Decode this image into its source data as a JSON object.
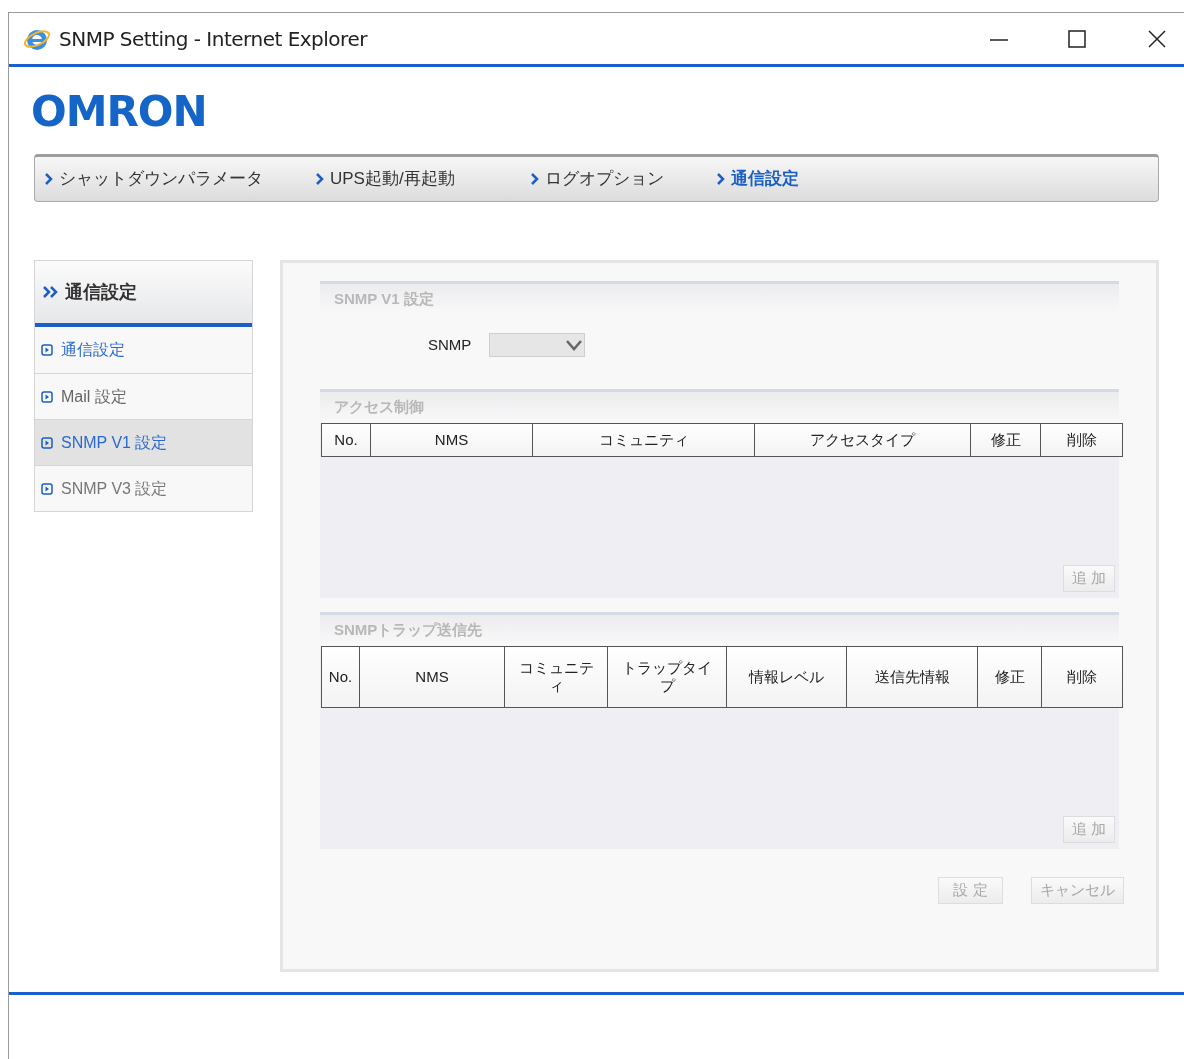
{
  "window": {
    "title": "SNMP Setting - Internet Explorer"
  },
  "logo": "OMRON",
  "nav": [
    {
      "label": "シャットダウンパラメータ",
      "selected": false
    },
    {
      "label": "UPS起動/再起動",
      "selected": false
    },
    {
      "label": "ログオプション",
      "selected": false
    },
    {
      "label": "通信設定",
      "selected": true
    }
  ],
  "sidebar": {
    "title": "通信設定",
    "items": [
      {
        "label": "通信設定",
        "selected": false,
        "color": "#2a6ad0"
      },
      {
        "label": "Mail 設定",
        "selected": false,
        "color": "#666666"
      },
      {
        "label": "SNMP V1 設定",
        "selected": true,
        "color": "#2a6ad0"
      },
      {
        "label": "SNMP V3 設定",
        "selected": false,
        "color": "#777777"
      }
    ]
  },
  "sections": [
    {
      "title": "SNMP V1 設定",
      "kind": "form",
      "field_label": "SNMP"
    },
    {
      "title": "アクセス制御",
      "kind": "table",
      "columns": [
        "No.",
        "NMS",
        "コミュニティ",
        "アクセスタイプ",
        "修正",
        "削除"
      ],
      "add_button": {
        "label": "追 加",
        "disabled": true
      }
    },
    {
      "title": "SNMPトラップ送信先",
      "kind": "table",
      "columns": [
        "No.",
        "NMS",
        "コミュニティ",
        "トラップタイプ",
        "情報レベル",
        "送信先情報",
        "修正",
        "削除"
      ],
      "add_button": {
        "label": "追 加",
        "disabled": true
      }
    }
  ],
  "buttons": [
    {
      "label": "設 定",
      "disabled": true
    },
    {
      "label": "キャンセル",
      "disabled": true
    }
  ]
}
